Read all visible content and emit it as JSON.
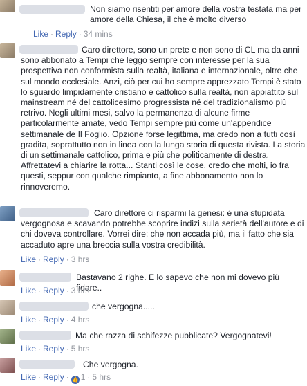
{
  "comments": [
    {
      "text": "Non siamo risentiti per amore della vostra testata ma per\namore della Chiesa, il che è molto diverso",
      "like": "Like",
      "reply": "Reply",
      "time": "34 mins"
    },
    {
      "text": "Caro direttore, sono un prete e non sono di CL ma da anni\nsono abbonato a Tempi che leggo sempre con interesse per la sua\nprospettiva non conformista sulla realtà, italiana e internazionale, oltre che\nsul mondo ecclesiale. Anzi, ciò per cui ho sempre apprezzato Tempi è stato\nlo sguardo limpidamente cristiano e cattolico sulla realtà, non appiattito sul\nmainstream né del cattolicesimo progressista né del tradizionalismo più\nretrivo. Negli ultimi mesi, salvo la permanenza di alcune firme\nparticolarmente amate, vedo Tempi sempre più come un'appendice\nsettimanale de Il Foglio. Opzione forse legittima, ma credo non a tutti così\ngradita, soprattutto non in linea con la lunga storia di questa rivista. La storia\ndi un settimanale cattolico, prima e più che politicamente di destra.\nAffrettatevi a chiarire la rotta... Stanti così le cose, credo che molti, io fra\nquesti, seppur con qualche rimpianto, a fine abbonamento non lo\nrinnoveremo."
    },
    {
      "text": "Caro direttore ci risparmi la genesi: è una stupidata\nvergognosa e scavando potrebbe scoprire indizi sulla serietà dell'autore e di\nchi doveva controllare. Vorrei dire: che non accada più, ma il fatto che sia\naccaduto apre una breccia sulla vostra credibilità.",
      "like": "Like",
      "reply": "Reply",
      "time": "3 hrs"
    },
    {
      "text": "Bastavano 2 righe. E lo sapevo che non mi dovevo più fidare..",
      "like": "Like",
      "reply": "Reply",
      "time": "3 hrs"
    },
    {
      "text": "che vergogna.....",
      "like": "Like",
      "reply": "Reply",
      "time": "4 hrs"
    },
    {
      "text": "Ma che razza di schifezze pubblicate? Vergognatevi!",
      "like": "Like",
      "reply": "Reply",
      "time": "5 hrs"
    },
    {
      "text": "Che vergogna.",
      "like": "Like",
      "reply": "Reply",
      "reaction_count": "1",
      "time": "5 hrs"
    }
  ],
  "separator": "·",
  "colors": {
    "link": "#4267b2",
    "meta": "#90949c",
    "text": "#1d2129",
    "name_blur": "#d8dbe3"
  }
}
